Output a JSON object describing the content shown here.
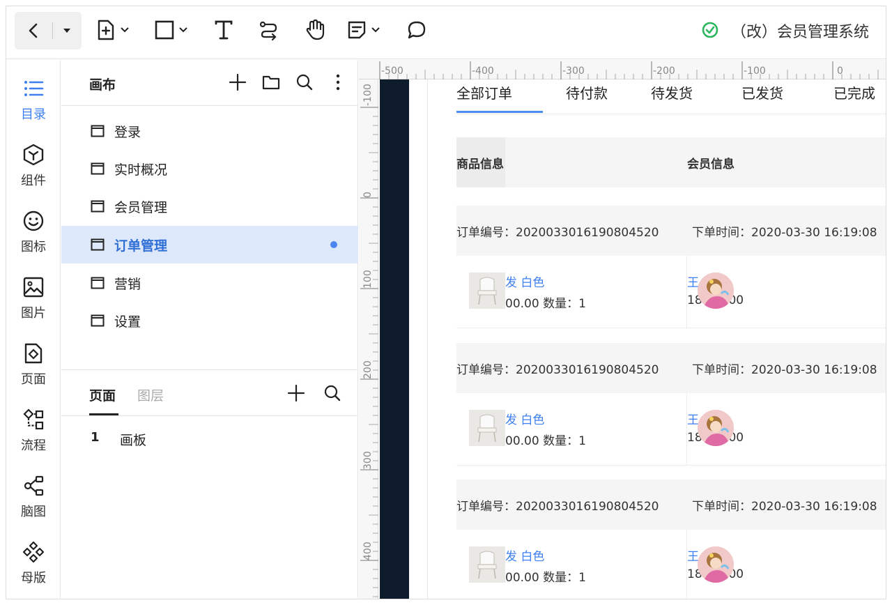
{
  "toolbar": {
    "doc_title": "（改）会员管理系统",
    "tools": [
      "back-icon",
      "dropdown-icon",
      "add-page-icon",
      "rectangle-icon",
      "text-icon",
      "connector-icon",
      "hand-icon",
      "note-icon",
      "comment-icon"
    ],
    "status": "saved"
  },
  "rail": {
    "items": [
      {
        "label": "目录",
        "icon": "list-icon",
        "active": true
      },
      {
        "label": "组件",
        "icon": "component-icon",
        "active": false
      },
      {
        "label": "图标",
        "icon": "smiley-icon",
        "active": false
      },
      {
        "label": "图片",
        "icon": "image-icon",
        "active": false
      },
      {
        "label": "页面",
        "icon": "page-icon",
        "active": false
      },
      {
        "label": "流程",
        "icon": "flow-icon",
        "active": false
      },
      {
        "label": "脑图",
        "icon": "mindmap-icon",
        "active": false
      },
      {
        "label": "母版",
        "icon": "master-icon",
        "active": false
      }
    ]
  },
  "panel": {
    "title": "画布",
    "pages": [
      {
        "label": "登录"
      },
      {
        "label": "实时概况"
      },
      {
        "label": "会员管理"
      },
      {
        "label": "订单管理",
        "selected": true
      },
      {
        "label": "营销"
      },
      {
        "label": "设置"
      }
    ],
    "lower_tabs": {
      "pages": "页面",
      "layers": "图层"
    },
    "layer": {
      "num": "1",
      "name": "画板"
    }
  },
  "ruler": {
    "top": [
      "-500",
      "-400",
      "-300",
      "-200",
      "-100",
      "0"
    ],
    "left": [
      "-100",
      "0",
      "100",
      "200",
      "300",
      "400"
    ]
  },
  "orders": {
    "tabs": [
      "全部订单",
      "待付款",
      "待发货",
      "已发货",
      "已完成"
    ],
    "headers": {
      "product": "商品信息",
      "member": "会员信息"
    },
    "rows": [
      {
        "order_no": "订单编号：2020033016190804520",
        "time": "下单时间：2020-03-30 16:19:08",
        "title": "发 白色",
        "price": "00.00 数量：1",
        "name": "王",
        "phone": "18      39000"
      },
      {
        "order_no": "订单编号：2020033016190804520",
        "time": "下单时间：2020-03-30 16:19:08",
        "title": "发 白色",
        "price": "00.00 数量：1",
        "name": "王",
        "phone": "18      39000"
      },
      {
        "order_no": "订单编号：2020033016190804520",
        "time": "下单时间：2020-03-30 16:19:08",
        "title": "发 白色",
        "price": "00.00 数量：1",
        "name": "王",
        "phone": "18      39000"
      }
    ]
  },
  "colors": {
    "accent": "#3d7ff0",
    "selected_bg": "#dde8fb",
    "dark_strip": "#0e1c2b",
    "check": "#2db55d"
  }
}
